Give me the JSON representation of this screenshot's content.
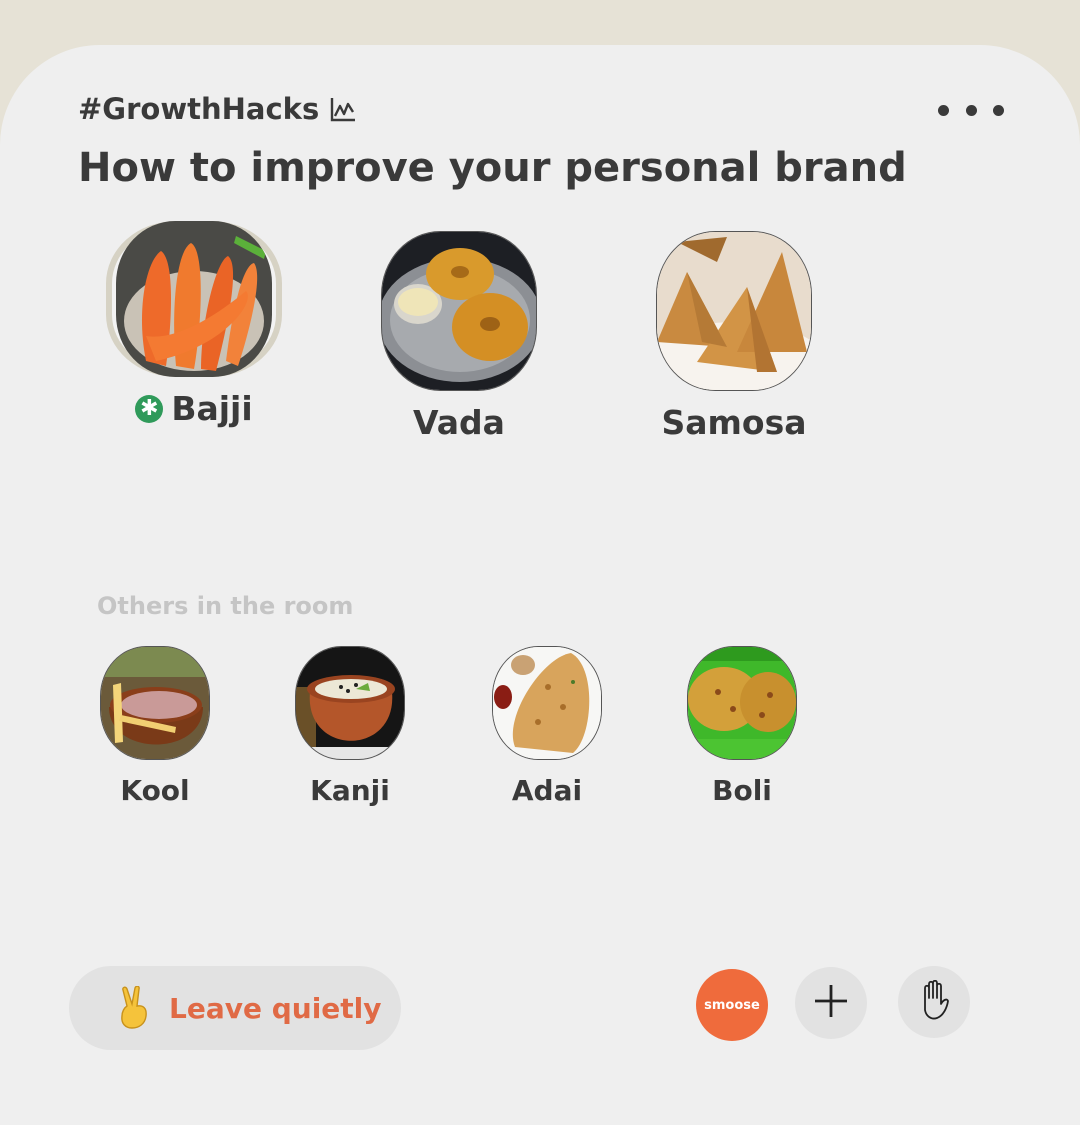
{
  "room": {
    "topic": "#GrowthHacks",
    "topic_icon": "chart-icon",
    "title": "How to improve your personal brand"
  },
  "speakers": [
    {
      "name": "Bajji",
      "moderator": true
    },
    {
      "name": "Vada",
      "moderator": false
    },
    {
      "name": "Samosa",
      "moderator": false
    }
  ],
  "others_label": "Others in the room",
  "listeners": [
    {
      "name": "Kool"
    },
    {
      "name": "Kanji"
    },
    {
      "name": "Adai"
    },
    {
      "name": "Boli"
    }
  ],
  "actions": {
    "leave_label": "Leave quietly",
    "leave_icon": "victory-hand-icon",
    "smoose_label": "smoose",
    "add_icon": "plus-icon",
    "raise_hand_icon": "hand-icon"
  },
  "colors": {
    "accent": "#e06a45",
    "smoose": "#ef6b3c",
    "moderator_badge": "#2f9a5a"
  }
}
